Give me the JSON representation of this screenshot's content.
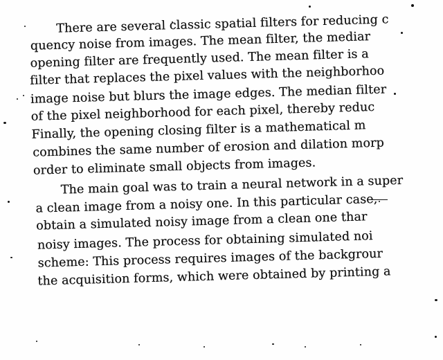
{
  "document": {
    "lines": [
      "There are several classic spatial filters for reducing c",
      "quency noise from images. The mean filter, the mediar",
      "opening filter are frequently used. The mean filter is a",
      "filter that replaces the pixel values with the neighborhoo",
      "image noise but blurs the image edges. The median filter",
      "of the pixel neighborhood for each pixel, thereby reduc",
      "Finally, the opening closing filter is a mathematical m",
      "combines the same number of erosion and dilation morp",
      "order to eliminate small objects from images.",
      "The main goal was to train a neural network in a super",
      "a clean image from a noisy one. In this particular case,",
      "obtain a simulated noisy image from a clean one thar",
      "noisy images. The process for obtaining simulated noi",
      "scheme: This process requires images of the backgrour",
      "the acquisition forms, which were obtained by printing a"
    ]
  }
}
